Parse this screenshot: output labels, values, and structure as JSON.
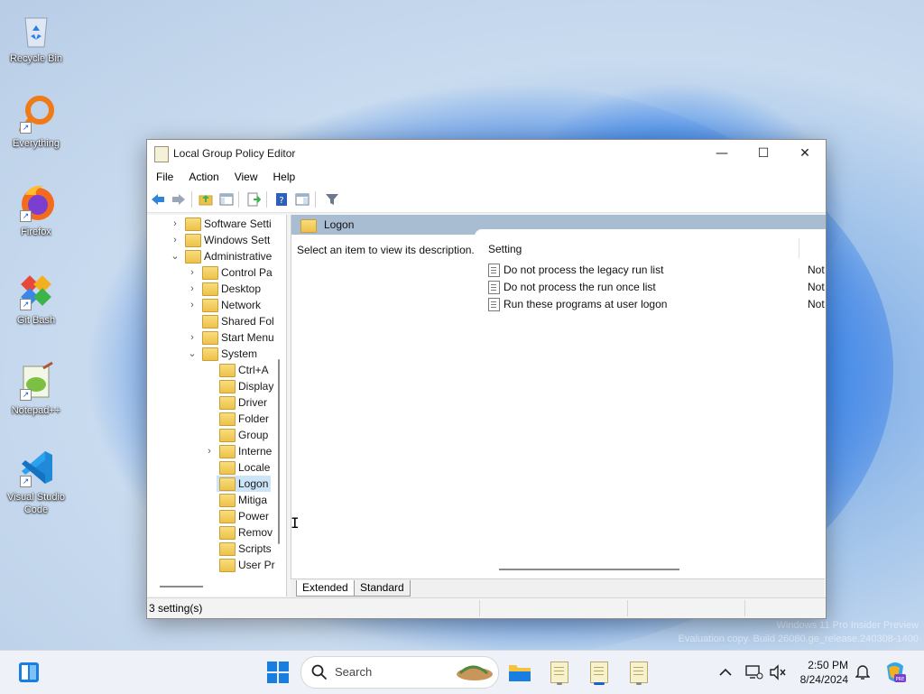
{
  "desktop": {
    "icons": [
      {
        "label": "Recycle Bin"
      },
      {
        "label": "Everything"
      },
      {
        "label": "Firefox"
      },
      {
        "label": "Git Bash"
      },
      {
        "label": "Notepad++"
      },
      {
        "label": "Visual Studio Code"
      }
    ],
    "watermark": {
      "line1": "Windows 11 Pro Insider Preview",
      "line2": "Evaluation copy. Build 26080.ge_release.240308-1400"
    }
  },
  "window": {
    "title": "Local Group Policy Editor",
    "controls": {
      "minimize": "—",
      "maximize": "☐",
      "close": "✕"
    },
    "menu": [
      "File",
      "Action",
      "View",
      "Help"
    ],
    "tree": [
      {
        "label": "Software Setti",
        "expander": "›",
        "level": 1
      },
      {
        "label": "Windows Sett",
        "expander": "›",
        "level": 1
      },
      {
        "label": "Administrative",
        "expander": "⌄",
        "level": 1
      },
      {
        "label": "Control Pa",
        "expander": "›",
        "level": 2
      },
      {
        "label": "Desktop",
        "expander": "›",
        "level": 2
      },
      {
        "label": "Network",
        "expander": "›",
        "level": 2
      },
      {
        "label": "Shared Fol",
        "expander": "",
        "level": 2
      },
      {
        "label": "Start Menu",
        "expander": "›",
        "level": 2
      },
      {
        "label": "System",
        "expander": "⌄",
        "level": 2
      },
      {
        "label": "Ctrl+A",
        "expander": "",
        "level": 3
      },
      {
        "label": "Display",
        "expander": "",
        "level": 3
      },
      {
        "label": "Driver",
        "expander": "",
        "level": 3
      },
      {
        "label": "Folder",
        "expander": "",
        "level": 3
      },
      {
        "label": "Group",
        "expander": "",
        "level": 3
      },
      {
        "label": "Interne",
        "expander": "›",
        "level": 3
      },
      {
        "label": "Locale",
        "expander": "",
        "level": 3
      },
      {
        "label": "Logon",
        "expander": "",
        "level": 3,
        "selected": true
      },
      {
        "label": "Mitiga",
        "expander": "",
        "level": 3
      },
      {
        "label": "Power",
        "expander": "",
        "level": 3
      },
      {
        "label": "Remov",
        "expander": "",
        "level": 3
      },
      {
        "label": "Scripts",
        "expander": "",
        "level": 3
      },
      {
        "label": "User Pr",
        "expander": "",
        "level": 3
      }
    ],
    "details": {
      "header": "Logon",
      "description": "Select an item to view its description.",
      "column_setting": "Setting",
      "rows": [
        {
          "name": "Do not process the legacy run list",
          "state": "Not"
        },
        {
          "name": "Do not process the run once list",
          "state": "Not"
        },
        {
          "name": "Run these programs at user logon",
          "state": "Not"
        }
      ]
    },
    "tabs": [
      "Extended",
      "Standard"
    ],
    "status": "3 setting(s)"
  },
  "taskbar": {
    "search_label": "Search",
    "clock_time": "2:50 PM",
    "clock_date": "8/24/2024"
  }
}
